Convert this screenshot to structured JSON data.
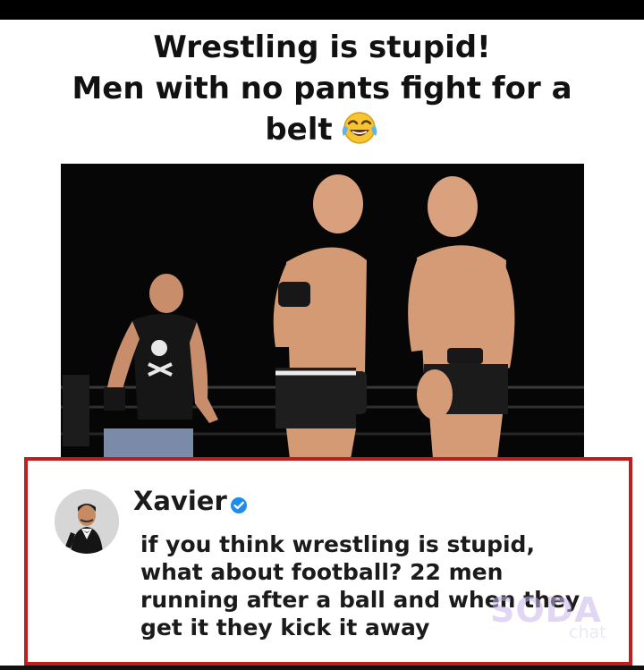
{
  "meme": {
    "headline_lines": [
      "Wrestling is stupid!",
      "Men with no pants fight for a",
      "belt"
    ],
    "emoji_icon": "tears-of-joy-emoji-icon"
  },
  "photo": {
    "subject": "wrestling-ring-photo"
  },
  "comment": {
    "author": "Xavier",
    "verified_icon": "verified-badge-icon",
    "text_lines": [
      "if you think wrestling is stupid,",
      "what about football? 22 men",
      "running after a ball and when they",
      "get it they kick it away"
    ],
    "frame_color": "#c21d1d"
  },
  "watermark": {
    "main": "SODA",
    "sub": "chat"
  }
}
